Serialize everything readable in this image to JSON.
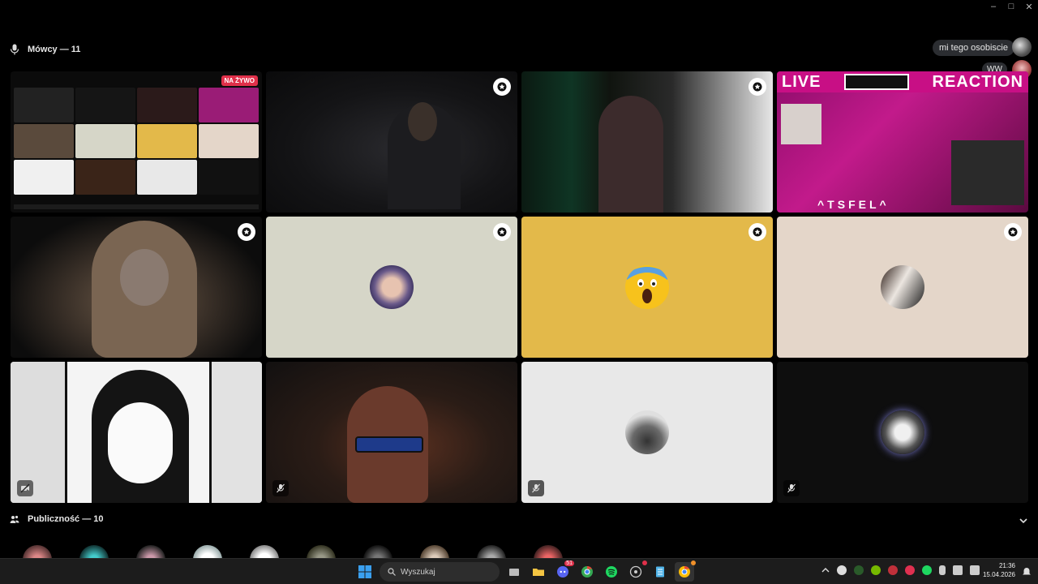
{
  "window": {
    "minimize": "–",
    "maximize": "□",
    "close": "✕"
  },
  "stage": {
    "speakers_label": "Mówcy — 11"
  },
  "chat": {
    "message_1": "mi tego osobiscie",
    "message_2": "WW"
  },
  "tiles": [
    {
      "id": "screen-share",
      "live_label": "NA ŻYWO"
    },
    {
      "id": "cam-2"
    },
    {
      "id": "cam-3"
    },
    {
      "id": "cam-4",
      "banner_left": "LIVE",
      "banner_right": "REACTION",
      "overlay_text": "^TSFEL^"
    },
    {
      "id": "cam-5"
    },
    {
      "id": "avatar-6",
      "bg": "#d6d6c8"
    },
    {
      "id": "avatar-7",
      "bg": "#e3b94a"
    },
    {
      "id": "avatar-8",
      "bg": "#e4d6c9"
    },
    {
      "id": "manga-9"
    },
    {
      "id": "cam-10"
    },
    {
      "id": "avatar-11",
      "bg": "#e8e8e8"
    },
    {
      "id": "avatar-12",
      "bg": "#0e0e0e"
    }
  ],
  "audience": {
    "label": "Publiczność — 10"
  },
  "taskbar": {
    "search_placeholder": "Wyszukaj",
    "discord_badge": "51",
    "time": "21:36",
    "date": "15.04.2026"
  },
  "colors": {
    "live_red": "#e0304a",
    "tile_yellow": "#e3b94a",
    "tile_beige": "#d6d6c8"
  }
}
